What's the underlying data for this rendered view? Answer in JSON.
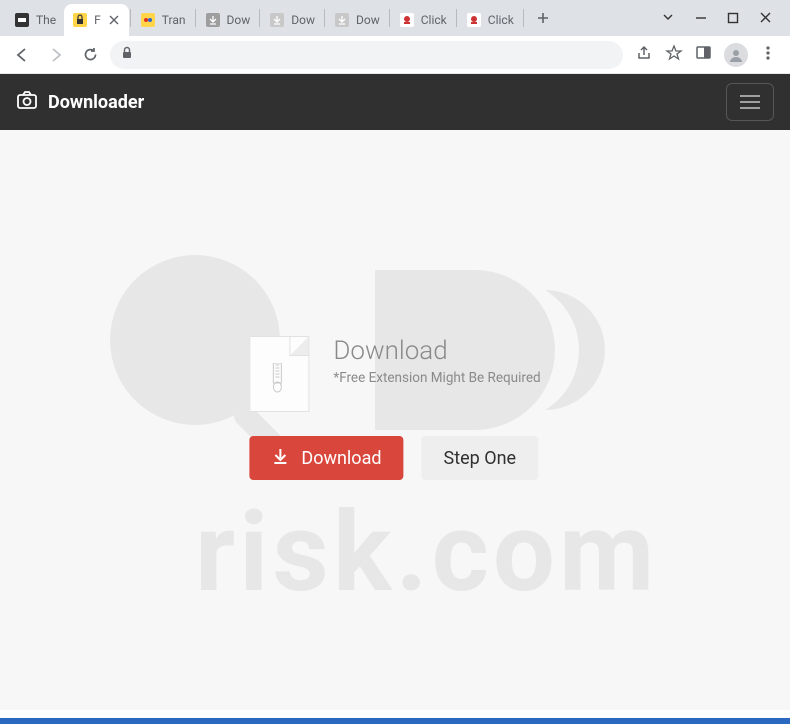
{
  "tabs": [
    {
      "title": "The"
    },
    {
      "title": "F"
    },
    {
      "title": "Tran"
    },
    {
      "title": "Dow"
    },
    {
      "title": "Dow"
    },
    {
      "title": "Dow"
    },
    {
      "title": "Click"
    },
    {
      "title": "Click"
    }
  ],
  "header": {
    "brand": "Downloader"
  },
  "main": {
    "heading": "Download",
    "subtext": "*Free Extension Might Be Required",
    "download_btn": "Download",
    "step_btn": "Step One"
  }
}
